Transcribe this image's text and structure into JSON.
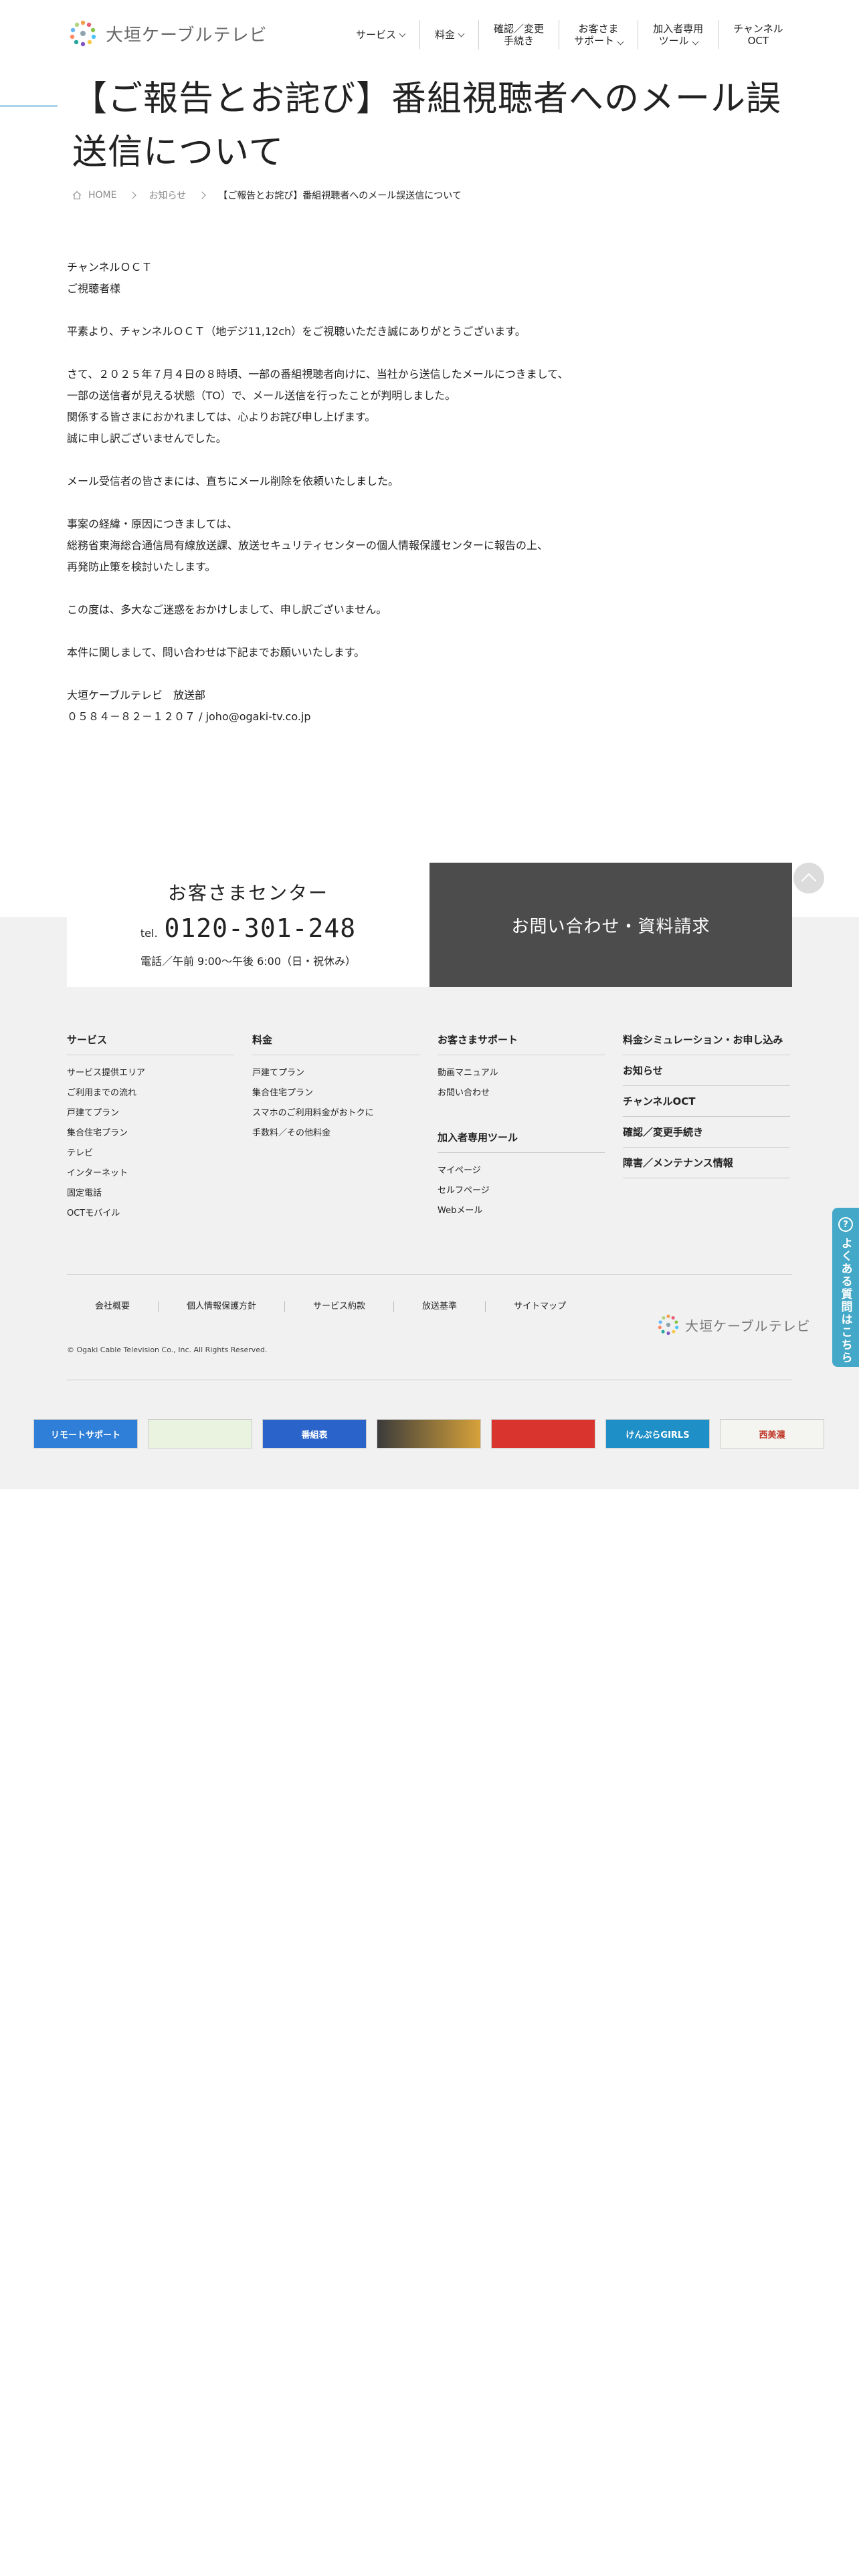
{
  "header": {
    "logo_text": "大垣ケーブルテレビ",
    "nav": [
      {
        "line1": "サービス",
        "line2": "",
        "dropdown": true
      },
      {
        "line1": "料金",
        "line2": "",
        "dropdown": true
      },
      {
        "line1": "確認／変更",
        "line2": "手続き",
        "dropdown": false
      },
      {
        "line1": "お客さま",
        "line2": "サポート",
        "dropdown": true
      },
      {
        "line1": "加入者専用",
        "line2": "ツール",
        "dropdown": true
      },
      {
        "line1": "チャンネル",
        "line2": "OCT",
        "dropdown": false
      }
    ]
  },
  "page": {
    "title": "【ご報告とお詫び】番組視聴者へのメール誤送信について"
  },
  "breadcrumb": {
    "home": "HOME",
    "parent": "お知らせ",
    "current": "【ご報告とお詫び】番組視聴者へのメール誤送信について"
  },
  "article": {
    "lines": [
      "チャンネルＯＣＴ",
      "ご視聴者様",
      "",
      "平素より、チャンネルＯＣＴ（地デジ11,12ch）をご視聴いただき誠にありがとうございます。",
      "",
      "さて、２０２５年７月４日の８時頃、一部の番組視聴者向けに、当社から送信したメールにつきまして、",
      "一部の送信者が見える状態（TO）で、メール送信を行ったことが判明しました。",
      "関係する皆さまにおかれましては、心よりお詫び申し上げます。",
      "誠に申し訳ございませんでした。",
      "",
      "メール受信者の皆さまには、直ちにメール削除を依頼いたしました。",
      "",
      "事案の経緯・原因につきましては、",
      "総務省東海総合通信局有線放送課、放送セキュリティセンターの個人情報保護センターに報告の上、",
      "再発防止策を検討いたします。",
      "",
      "この度は、多大なご迷惑をおかけしまして、申し訳ございません。",
      "",
      "本件に関しまして、問い合わせは下記までお願いいたします。",
      "",
      "大垣ケーブルテレビ　放送部",
      "０５８４－８２－１２０７ / joho@ogaki-tv.co.jp"
    ]
  },
  "contact": {
    "center_title": "お客さまセンター",
    "tel_label": "tel.",
    "tel_number": "0120-301-248",
    "hours": "電話／午前 9:00〜午後 6:00（日・祝休み）",
    "inquiry_label": "お問い合わせ・資料請求"
  },
  "footer": {
    "col1": {
      "title": "サービス",
      "links": [
        "サービス提供エリア",
        "ご利用までの流れ",
        "戸建てプラン",
        "集合住宅プラン",
        "テレビ",
        "インターネット",
        "固定電話",
        "OCTモバイル"
      ]
    },
    "col2": {
      "title": "料金",
      "links": [
        "戸建てプラン",
        "集合住宅プラン",
        "スマホのご利用料金がおトクに",
        "手数料／その他料金"
      ]
    },
    "col3": {
      "title": "お客さまサポート",
      "links": [
        "動画マニュアル",
        "お問い合わせ"
      ],
      "title2": "加入者専用ツール",
      "links2": [
        "マイページ",
        "セルフページ",
        "Webメール"
      ]
    },
    "col4": {
      "items": [
        "料金シミュレーション・お申し込み",
        "お知らせ",
        "チャンネルOCT",
        "確認／変更手続き",
        "障害／メンテナンス情報"
      ]
    },
    "bottom_links": [
      "会社概要",
      "個人情報保護方針",
      "サービス約款",
      "放送基準",
      "サイトマップ"
    ],
    "copyright": "© Ogaki Cable Television Co., Inc. All Rights Reserved.",
    "logo_text": "大垣ケーブルテレビ"
  },
  "banners": [
    {
      "label": "リモートサポート",
      "bg": "#2f7fd8"
    },
    {
      "label": "",
      "bg": "#e9f3e0"
    },
    {
      "label": "番組表",
      "bg": "#2a63c9"
    },
    {
      "label": "",
      "bg": "#3b3b3b"
    },
    {
      "label": "",
      "bg": "#d9352e"
    },
    {
      "label": "けんぷらGIRLS",
      "bg": "#1f8fc7"
    },
    {
      "label": "西美濃",
      "bg": "#f4f4f0"
    }
  ],
  "faq_tab": {
    "label": "よくある質問はこちら",
    "icon_glyph": "?"
  },
  "colors": {
    "accent": "#a9d4ec",
    "inquiry_bg": "#4c4c4c",
    "footer_bg": "#f1f1f1",
    "faq_tab": "#44a8c8"
  }
}
